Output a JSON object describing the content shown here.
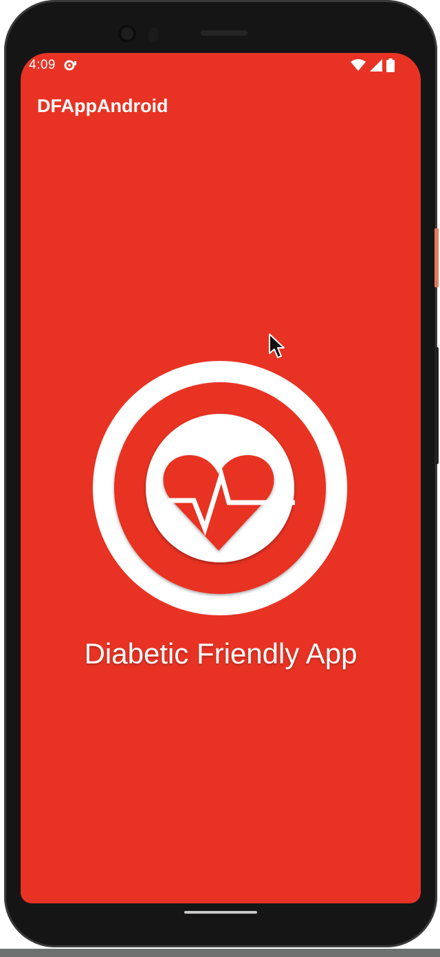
{
  "status_bar": {
    "time": "4:09",
    "icons": [
      "data-saver-icon",
      "wifi-icon",
      "signal-icon",
      "battery-icon"
    ]
  },
  "app_bar": {
    "title": "DFAppAndroid"
  },
  "splash": {
    "logo_icon": "heart-pulse-icon",
    "tagline": "Diabetic Friendly App"
  },
  "colors": {
    "primary": "#e83324",
    "logo_inner": "#ffffff",
    "text": "#ffffff"
  }
}
